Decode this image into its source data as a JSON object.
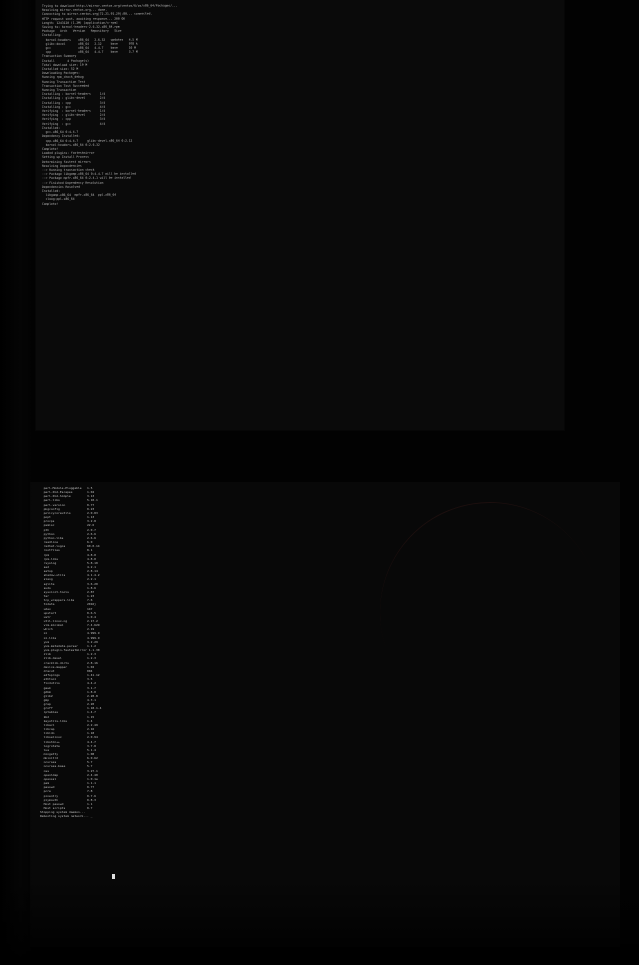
{
  "app": {
    "type": "terminal_photo"
  },
  "terminal_top": {
    "lines": [
      "Trying to download http://mirror.centos.org/centos/6/os/x86_64/Packages/...",
      "Resolving mirror.centos.org... done.",
      "Connecting to mirror.centos.org|72.21.91.29|:80... connected.",
      "HTTP request sent, awaiting response... 200 OK",
      "Length: 1243120 (1.2M) [application/x-rpm]",
      "Saving to: kernel-headers-2.6.32.x86_64.rpm",
      "Package   Arch   Version   Repository   Size",
      "Installing:",
      "  kernel-headers    x86_64   2.6.32   updates   4.5 M",
      "  glibc-devel       x86_64   2.12     base      978 k",
      "  gcc               x86_64   4.4.7    base      10 M",
      "  cpp               x86_64   4.4.7    base      3.7 M",
      "Transaction Summary",
      "Install       4 Package(s)",
      "Total download size: 19 M",
      "Installed size: 52 M",
      "Downloading Packages:",
      "Running rpm_check_debug",
      "Running Transaction Test",
      "Transaction Test Succeeded",
      "Running Transaction",
      "Installing : kernel-headers     1/4",
      "Installing : glibc-devel        2/4",
      "Installing : cpp                3/4",
      "Installing : gcc                4/4",
      "Verifying  : kernel-headers     1/4",
      "Verifying  : glibc-devel        2/4",
      "Verifying  : cpp                3/4",
      "Verifying  : gcc                4/4",
      "Installed:",
      "  gcc.x86_64 0:4.4.7",
      "Dependency Installed:",
      "  cpp.x86_64 0:4.4.7     glibc-devel.x86_64 0:2.12",
      "  kernel-headers.x86_64 0:2.6.32",
      "Complete!",
      "Loaded plugins: fastestmirror",
      "Setting up Install Process",
      "Determining fastest mirrors",
      "Resolving Dependencies",
      "--> Running transaction check",
      "--> Package libgomp.x86_64 0:4.4.7 will be installed",
      "--> Package mpfr.x86_64 0:2.4.1 will be installed",
      "--> Finished Dependency Resolution",
      "Dependencies Resolved",
      "Installed:",
      "  libgomp.x86_64  mpfr.x86_64  ppl.x86_64",
      "  cloog-ppl.x86_64",
      "Complete!"
    ]
  },
  "terminal_bottom": {
    "lines": [
      "  perl-Module-Pluggable   1.5",
      "  perl-Pod-Escapes        1.04",
      "  perl-Pod-Simple         3.13",
      "  perl-libs               5.10.1",
      "  perl-version            0.77",
      "  pkgconfig               0.23",
      "  policycoreutils         2.0.83",
      "  popt                    1.13",
      "  procps                  3.2.8",
      "  psmisc                  22.6",
      "  pth                     2.0.7",
      "  python                  2.6.6",
      "  python-libs             2.6.6",
      "  readline                6.0",
      "  redhat-logos            60.0.14",
      "  rootfiles               8.1",
      "  rpm                     4.8.0",
      "  rpm-libs                4.8.0",
      "  rsyslog                 5.8.10",
      "  sed                     4.2.1",
      "  setup                   2.8.14",
      "  shadow-utils            4.1.4.2",
      "  slang                   2.2.1",
      "  sqlite                  3.6.20",
      "  sudo                    1.8.6",
      "  sysvinit-tools          2.87",
      "  tar                     1.23",
      "  tcp_wrappers-libs       7.6",
      "  tzdata                  2016j",
      "  udev                    147",
      "  upstart                 0.6.5",
      "  ustr                    1.0.4",
      "  util-linux-ng           2.17.2",
      "  vim-minimal             7.4.629",
      "  which                   2.19",
      "  xz                      4.999.9",
      "  xz-libs                 4.999.9",
      "  yum                     3.2.29",
      "  yum-metadata-parser     1.1.2",
      "  yum-plugin-fastestmirror 1.1.30",
      "  zlib                    1.2.3",
      "  zlib-devel              1.2.3",
      "  cracklib-dicts          2.8.16",
      "  device-mapper           1.02",
      "  dracut                  004",
      "  e2fsprogs               1.41.12",
      "  ethtool                 3.5",
      "  findutils               4.4.2",
      "  gawk                    3.1.7",
      "  gdbm                    1.8.0",
      "  glib2                   2.28.8",
      "  gmp                     4.3.1",
      "  grep                    2.20",
      "  groff                   1.18.1.4",
      "  iptables                1.4.7",
      "  kbd                     1.15",
      "  keyutils-libs           1.4",
      "  libacl                  2.2.49",
      "  libcap                  2.16",
      "  libidn                  1.18",
      "  libselinux              2.0.94",
      "  libstdc++               4.4.7",
      "  logrotate               3.7.8",
      "  lua                     5.1.4",
      "  mingetty                1.08",
      "  mkinitrd                6.0.62",
      "  ncurses                 5.7",
      "  ncurses-base            5.7",
      "  nss                     3.27.1",
      "  openldap                2.4.40",
      "  openssl                 1.0.1e",
      "  pam                     1.1.1",
      "  passwd                  0.77",
      "  pcre                    7.8",
      "  pinentry                0.7.6",
      "  plymouth                0.8.3",
      "  Host passwd             1.1",
      "  Host scripts            0.7",
      "Stopping system daemon...",
      "Rebooting system network... _"
    ]
  }
}
